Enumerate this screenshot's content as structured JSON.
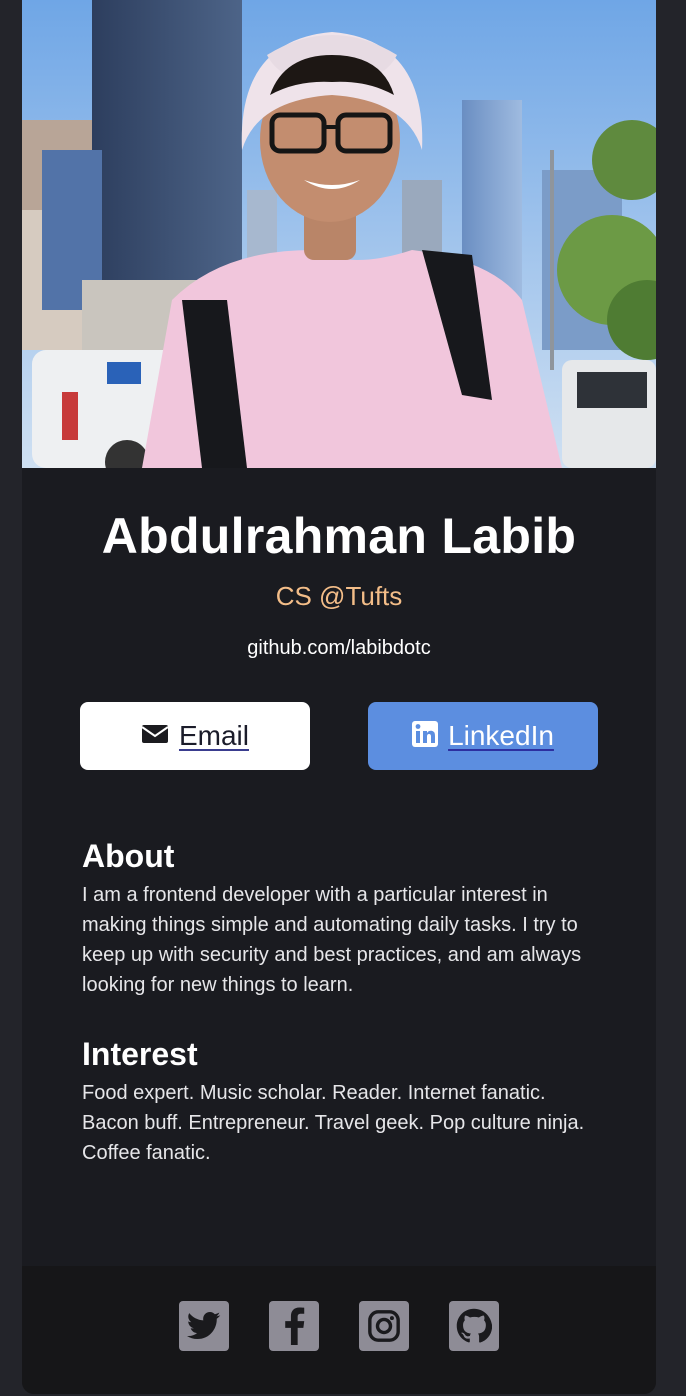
{
  "profile": {
    "name": "Abdulrahman Labib",
    "role": "CS @Tufts",
    "website": "github.com/labibdotc"
  },
  "buttons": {
    "email_label": "Email",
    "email_icon": "envelope-icon",
    "linkedin_label": "LinkedIn",
    "linkedin_icon": "linkedin-icon"
  },
  "about": {
    "title": "About",
    "body": "I am a frontend developer with a particular interest in making things simple and automating daily tasks. I try to keep up with security and best practices, and am always looking for new things to learn."
  },
  "interest": {
    "title": "Interest",
    "body": "Food expert. Music scholar. Reader. Internet fanatic. Bacon buff. Entrepreneur. Travel geek. Pop culture ninja. Coffee fanatic."
  },
  "footer": {
    "social_icons": [
      "twitter-icon",
      "facebook-icon",
      "instagram-icon",
      "github-icon"
    ]
  },
  "colors": {
    "background": "#23242a",
    "card": "#1a1b20",
    "footer": "#161618",
    "role_accent": "#f3bd88",
    "linkedin_button": "#5c8ee0",
    "social_icon_bg": "#8e8c96"
  }
}
